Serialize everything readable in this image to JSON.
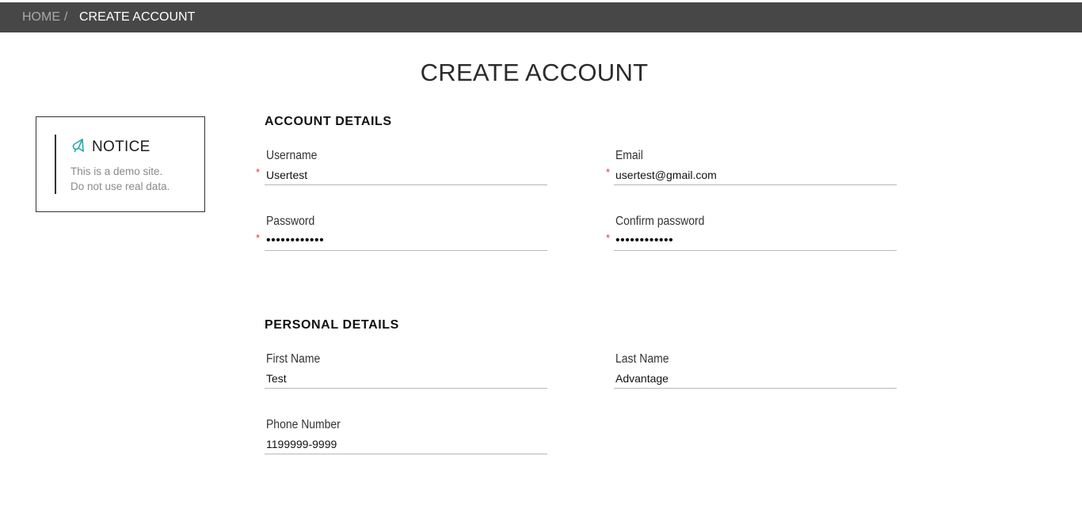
{
  "breadcrumb": {
    "home": "HOME",
    "separator": "/",
    "current": "CREATE ACCOUNT"
  },
  "page": {
    "title": "CREATE ACCOUNT"
  },
  "notice": {
    "icon": "bell-icon",
    "title": "NOTICE",
    "line1": "This is a demo site.",
    "line2": "Do not use real data."
  },
  "account_details": {
    "title": "ACCOUNT DETAILS",
    "username": {
      "label": "Username",
      "value": "Usertest",
      "required": "*"
    },
    "email": {
      "label": "Email",
      "value": "usertest@gmail.com",
      "required": "*"
    },
    "password": {
      "label": "Password",
      "value": "••••••••••••",
      "required": "*"
    },
    "confirm_password": {
      "label": "Confirm password",
      "value": "••••••••••••",
      "required": "*"
    }
  },
  "personal_details": {
    "title": "PERSONAL DETAILS",
    "first_name": {
      "label": "First Name",
      "value": "Test"
    },
    "last_name": {
      "label": "Last Name",
      "value": "Advantage"
    },
    "phone_number": {
      "label": "Phone Number",
      "value": "1199999-9999"
    }
  },
  "colors": {
    "topbar": "#474747",
    "required_star": "#e0353d",
    "notice_icon": "#2aa8a8"
  }
}
